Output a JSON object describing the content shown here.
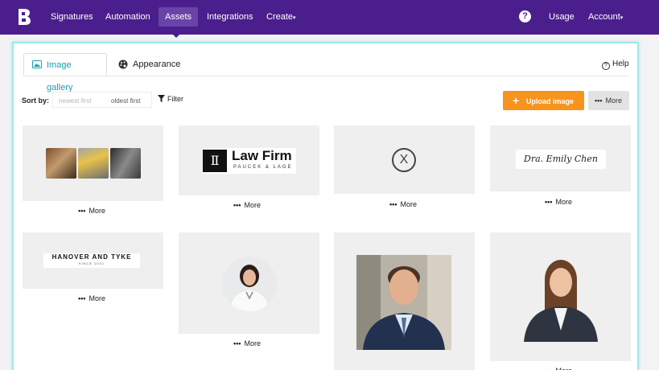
{
  "nav": {
    "logo": "B",
    "items": [
      {
        "label": "Signatures"
      },
      {
        "label": "Automation"
      },
      {
        "label": "Assets"
      },
      {
        "label": "Integrations"
      },
      {
        "label": "Create"
      }
    ],
    "active": "Assets",
    "help_icon": "question-circle-icon",
    "usage": "Usage",
    "account": "Account"
  },
  "tabs": {
    "gallery": "Image gallery",
    "appearance": "Appearance",
    "help": "Help"
  },
  "toolbar": {
    "sort_label": "Sort by:",
    "sort_newest": "newest first",
    "sort_oldest": "oldest first",
    "filter": "Filter",
    "upload": "Upload image",
    "more": "More"
  },
  "gallery": {
    "more_label": "More",
    "lawfirm": {
      "title": "Law Firm",
      "subtitle": "PAUCEK & LAGE"
    },
    "signature": "Dra. Emily Chen",
    "hanover": {
      "title": "HANOVER AND TYKE",
      "subtitle": "SINCE 2001"
    },
    "x_logo": "X"
  },
  "colors": {
    "nav_bg": "#4a1f8d",
    "accent": "#1a9fb0",
    "upload": "#f7941d",
    "panel_border": "#9fe6ea"
  }
}
